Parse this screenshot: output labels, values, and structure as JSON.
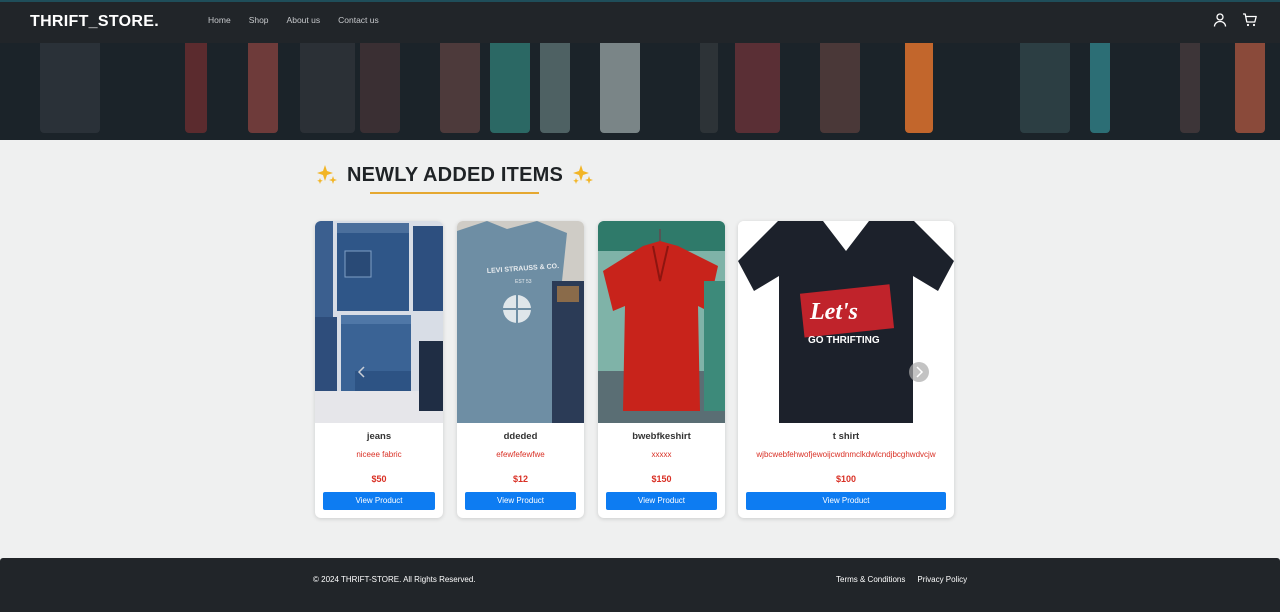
{
  "brand": "THRIFT_STORE.",
  "nav": {
    "items": [
      "Home",
      "Shop",
      "About us",
      "Contact us"
    ]
  },
  "header_icons": [
    "user-icon",
    "cart-icon"
  ],
  "section": {
    "title": "NEWLY ADDED ITEMS",
    "emoji": "sparkles-icon"
  },
  "products": [
    {
      "name": "jeans",
      "description": "niceee fabric",
      "price": "$50",
      "button": "View Product"
    },
    {
      "name": "ddeded",
      "description": "efewfefewfwe",
      "price": "$12",
      "button": "View Product"
    },
    {
      "name": "bwebfkeshirt",
      "description": "xxxxx",
      "price": "$150",
      "button": "View Product"
    },
    {
      "name": "t shirt",
      "description": "wjbcwebfehwofjewoijcwdnmclkdwlcndjbcghwdvcjw",
      "price": "$100",
      "button": "View Product"
    }
  ],
  "tshirt_print": {
    "line1": "Let's",
    "line2": "GO THRIFTING"
  },
  "tee_print": {
    "line1": "LEVI STRAUSS & CO.",
    "line2": "EST 53"
  },
  "footer": {
    "copyright": "© 2024 THRIFT-STORE. All Rights Reserved.",
    "links": [
      "Terms & Conditions",
      "Privacy Policy"
    ]
  },
  "colors": {
    "navbar": "#212529",
    "button": "#0d7cf2",
    "price": "#d93025",
    "underline": "#e5a831",
    "background": "#eff0f0"
  }
}
